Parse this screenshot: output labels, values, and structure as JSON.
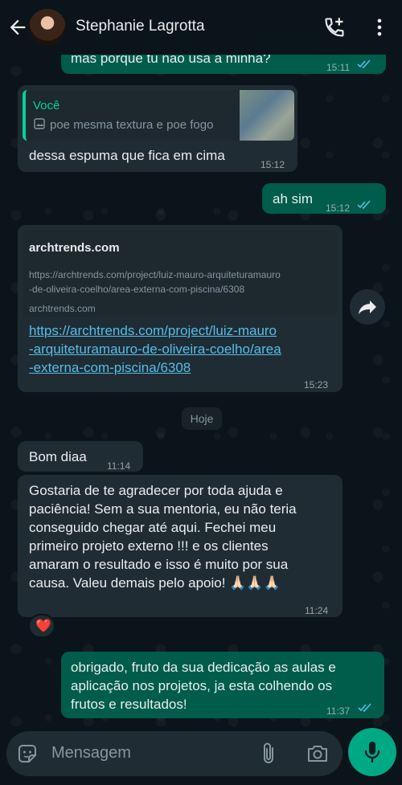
{
  "header": {
    "contact_name": "Stephanie Lagrotta"
  },
  "messages": [
    {
      "direction": "out",
      "text": "mas porque tu não usa a minha?",
      "time": "15:11",
      "read": true
    },
    {
      "direction": "in",
      "quote_author": "Você",
      "quote_text": "poe mesma textura e poe fogo",
      "text": "dessa espuma que fica em cima",
      "time": "15:12"
    },
    {
      "direction": "out",
      "text": "ah sim",
      "time": "15:12",
      "read": true
    },
    {
      "direction": "in",
      "link_site": "archtrends.com",
      "link_url_preview_1": "https://archtrends.com/project/luiz-mauro-arquiteturamauro",
      "link_url_preview_2": "-de-oliveira-coelho/area-externa-com-piscina/6308",
      "link_domain": "archtrends.com",
      "link_line_1": "https://archtrends.com/project/luiz-mauro",
      "link_line_2": "-arquiteturamauro-de-oliveira-coelho/area",
      "link_line_3": "-externa-com-piscina/6308",
      "time": "15:23"
    },
    {
      "direction": "in",
      "text": "Bom diaa",
      "time": "11:14"
    },
    {
      "direction": "in",
      "lines": [
        "Gostaria de te agradecer por toda ajuda e",
        "paciência! Sem a sua mentoria, eu não teria",
        "conseguido chegar até aqui. Fechei meu",
        "primeiro projeto externo !!! e os clientes",
        "amaram o resultado e isso é muito por sua",
        "causa. Valeu demais pelo apoio! 🙏🏻🙏🏻🙏🏻"
      ],
      "time": "11:24",
      "reaction": "❤️"
    },
    {
      "direction": "out",
      "lines": [
        "obrigado, fruto da sua dedicação as aulas e",
        "aplicação nos projetos, ja esta colhendo os",
        "frutos e resultados!"
      ],
      "time": "11:37",
      "read": true
    }
  ],
  "date_divider": "Hoje",
  "composer": {
    "placeholder": "Mensagem"
  },
  "colors": {
    "background": "#0b141a",
    "incoming_bubble": "#202c33",
    "outgoing_bubble": "#005c4b",
    "accent": "#00a884",
    "read_ticks": "#53bdeb",
    "quote_bar": "#06cf9c"
  },
  "icons": [
    "back-arrow-icon",
    "add-call-icon",
    "more-vert-icon",
    "image-icon",
    "forward-icon",
    "sticker-icon",
    "attach-icon",
    "camera-icon",
    "mic-icon",
    "read-ticks-icon"
  ]
}
